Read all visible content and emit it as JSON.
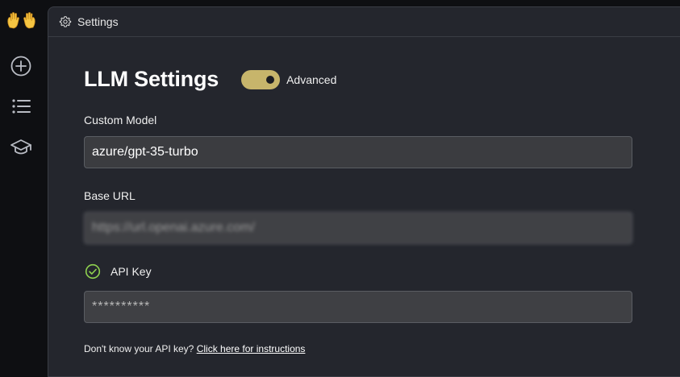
{
  "sidebar": {
    "logo": "raised-hands-logo",
    "items": [
      {
        "icon": "plus-circle-icon"
      },
      {
        "icon": "list-icon"
      },
      {
        "icon": "graduation-cap-icon"
      }
    ]
  },
  "header": {
    "icon": "gear-icon",
    "title": "Settings"
  },
  "llm": {
    "title": "LLM Settings",
    "advanced_toggle": {
      "label": "Advanced",
      "on": true,
      "color": "#c7b56b"
    },
    "custom_model": {
      "label": "Custom Model",
      "value": "azure/gpt-35-turbo"
    },
    "base_url": {
      "label": "Base URL",
      "value": "https://url.openai.azure.com/"
    },
    "api_key": {
      "label": "API Key",
      "status_icon": "check-circle-icon",
      "placeholder": "**********"
    },
    "help": {
      "text": "Don't know your API key? ",
      "link": "Click here for instructions"
    }
  }
}
